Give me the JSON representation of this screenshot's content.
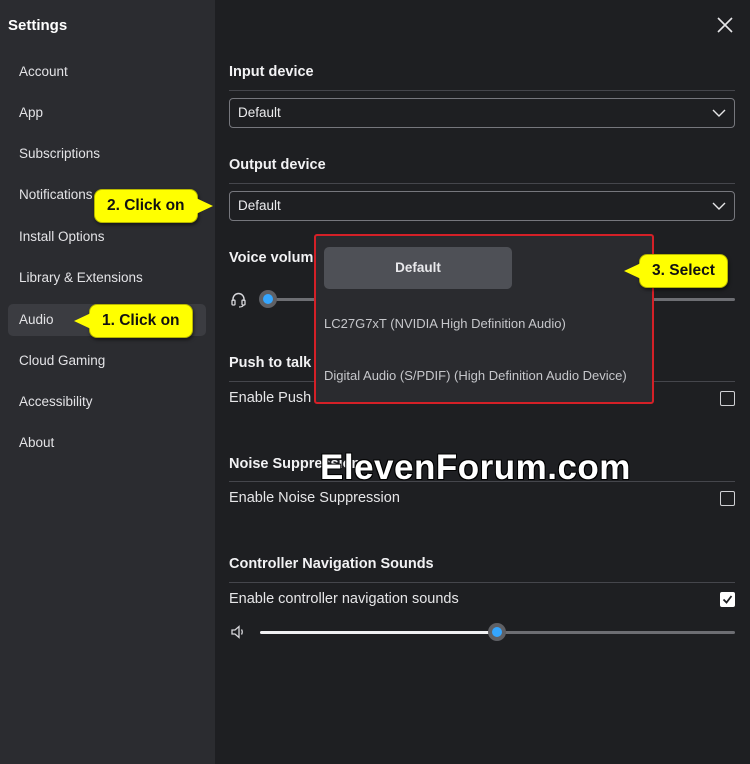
{
  "sidebar": {
    "title": "Settings",
    "items": [
      {
        "label": "Account"
      },
      {
        "label": "App"
      },
      {
        "label": "Subscriptions"
      },
      {
        "label": "Notifications"
      },
      {
        "label": "Install Options"
      },
      {
        "label": "Library & Extensions"
      },
      {
        "label": "Audio",
        "active": true
      },
      {
        "label": "Cloud Gaming"
      },
      {
        "label": "Accessibility"
      },
      {
        "label": "About"
      }
    ]
  },
  "main": {
    "close_icon": "close-icon",
    "input_device": {
      "title": "Input device",
      "value": "Default"
    },
    "output_device": {
      "title": "Output device",
      "value": "Default"
    },
    "voice_volume": {
      "title": "Voice volum",
      "icon": "headset-icon",
      "level": 0.0
    },
    "push_to_talk": {
      "title": "Push to talk",
      "enable_label": "Enable Push",
      "checked": false
    },
    "noise_suppression": {
      "title": "Noise Suppression",
      "enable_label": "Enable Noise Suppression",
      "checked": false
    },
    "controller_sounds": {
      "title": "Controller Navigation Sounds",
      "enable_label": "Enable controller navigation sounds",
      "checked": true,
      "icon": "speaker-icon",
      "level": 0.5
    }
  },
  "dropdown": {
    "options": [
      "Default",
      "LC27G7xT (NVIDIA High Definition Audio)",
      "Digital Audio (S/PDIF) (High Definition Audio Device)"
    ]
  },
  "callouts": {
    "step1": "1. Click on",
    "step2": "2. Click on",
    "step3": "3. Select"
  },
  "watermark": "ElevenForum.com",
  "colors": {
    "accent": "#35a6ff",
    "highlight": "#d42027",
    "callout": "#ffff00"
  }
}
